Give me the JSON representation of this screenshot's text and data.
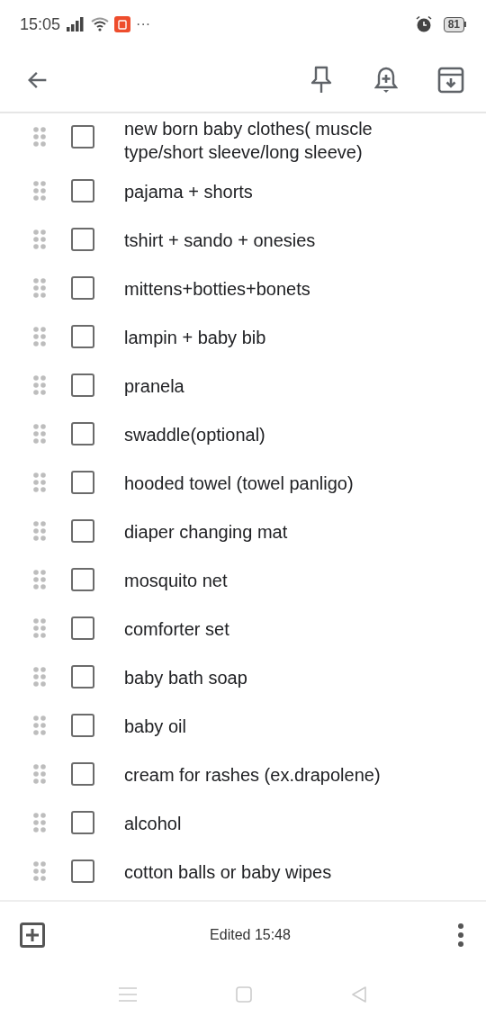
{
  "status_bar": {
    "time": "15:05",
    "more": "···",
    "battery": "81"
  },
  "items": [
    {
      "text": "new born baby clothes( muscle type/short sleeve/long sleeve)",
      "checked": false
    },
    {
      "text": "pajama + shorts",
      "checked": false
    },
    {
      "text": "tshirt + sando + onesies",
      "checked": false
    },
    {
      "text": "mittens+botties+bonets",
      "checked": false
    },
    {
      "text": "lampin + baby bib",
      "checked": false
    },
    {
      "text": "pranela",
      "checked": false
    },
    {
      "text": "swaddle(optional)",
      "checked": false
    },
    {
      "text": "hooded towel (towel panligo)",
      "checked": false
    },
    {
      "text": "diaper changing mat",
      "checked": false
    },
    {
      "text": "mosquito net",
      "checked": false
    },
    {
      "text": "comforter set",
      "checked": false
    },
    {
      "text": "baby bath soap",
      "checked": false
    },
    {
      "text": "baby oil",
      "checked": false
    },
    {
      "text": "cream for rashes (ex.drapolene)",
      "checked": false
    },
    {
      "text": "alcohol",
      "checked": false
    },
    {
      "text": "cotton balls or baby wipes",
      "checked": false
    }
  ],
  "footer": {
    "edited": "Edited 15:48"
  }
}
